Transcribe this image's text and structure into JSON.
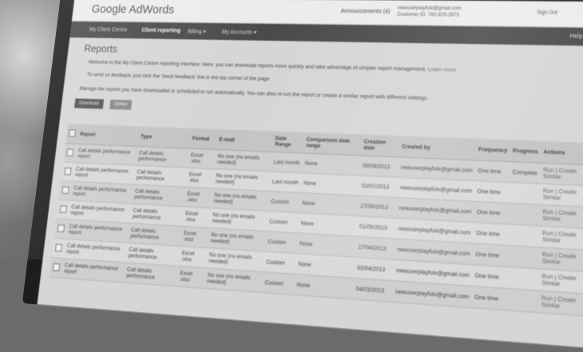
{
  "header": {
    "logo_text": "Google AdWords",
    "announcements": "Announcements (4)",
    "account_email": "newuserplayfulx@gmail.com",
    "account_id": "Customer ID: 783-925-2873",
    "signout": "Sign Out"
  },
  "nav": {
    "items": [
      "My Client Centre",
      "Client reporting",
      "Billing ▾",
      "My Accounts ▾"
    ],
    "help": "Help"
  },
  "page": {
    "title": "Reports",
    "welcome": "Welcome to the My Client Centre reporting interface. Here, you can download reports more quickly and take advantage of simpler report management.",
    "learn_more": "Learn more",
    "feedback": "To send us feedback, just click the 'Send feedback' link in the top corner of the page.",
    "manage": "Manage the reports you have downloaded or scheduled to run automatically. You can also re-run the report or create a similar report with different settings.",
    "download_button": "Download",
    "delete_button": "Delete"
  },
  "table": {
    "headers": [
      "",
      "Report",
      "Type",
      "Format",
      "E-mail",
      "Date Range",
      "Comparison date range",
      "Creation date",
      "Created by",
      "Frequency",
      "Progress",
      "Actions"
    ],
    "rows": [
      {
        "report": "Call details performance report",
        "type": "Call details performance",
        "format": "Excel .xlsx",
        "email": "No one (no emails needed)",
        "range": "Last month",
        "comparison": "None",
        "created": "09/08/2013",
        "by": "newuserplayfulx@gmail.com",
        "frequency": "One time",
        "progress": "Complete",
        "action": "Run | Create Similar"
      },
      {
        "report": "Call details performance report",
        "type": "Call details performance",
        "format": "Excel .xlsx",
        "email": "No one (no emails needed)",
        "range": "Last month",
        "comparison": "None",
        "created": "02/07/2013",
        "by": "newuserplayfulx@gmail.com",
        "frequency": "One time",
        "progress": "",
        "action": "Run | Create Similar"
      },
      {
        "report": "Call details performance report",
        "type": "Call details performance",
        "format": "Excel .xlsx",
        "email": "No one (no emails needed)",
        "range": "Custom",
        "comparison": "None",
        "created": "27/06/2013",
        "by": "newuserplayfulx@gmail.com",
        "frequency": "One time",
        "progress": "",
        "action": "Run | Create Similar"
      },
      {
        "report": "Call details performance report",
        "type": "Call details performance",
        "format": "Excel .xlsx",
        "email": "No one (no emails needed)",
        "range": "Custom",
        "comparison": "None",
        "created": "01/05/2013",
        "by": "newuserplayfulx@gmail.com",
        "frequency": "One time",
        "progress": "",
        "action": "Run | Create Similar"
      },
      {
        "report": "Call details performance report",
        "type": "Call details performance",
        "format": "Excel .xlsx",
        "email": "No one (no emails needed)",
        "range": "Custom",
        "comparison": "None",
        "created": "17/04/2013",
        "by": "newuserplayfulx@gmail.com",
        "frequency": "One time",
        "progress": "",
        "action": "Run | Create Similar"
      },
      {
        "report": "Call details performance report",
        "type": "Call details performance",
        "format": "Excel .xlsx",
        "email": "No one (no emails needed)",
        "range": "Custom",
        "comparison": "None",
        "created": "02/04/2013",
        "by": "newuserplayfulx@gmail.com",
        "frequency": "One time",
        "progress": "",
        "action": "Run | Create Similar"
      },
      {
        "report": "Call details performance report",
        "type": "Call details performance",
        "format": "Excel .xlsx",
        "email": "No one (no emails needed)",
        "range": "Custom",
        "comparison": "None",
        "created": "04/03/2013",
        "by": "newuserplayfulx@gmail.com",
        "frequency": "One time",
        "progress": "",
        "action": "Run | Create Similar"
      }
    ]
  }
}
